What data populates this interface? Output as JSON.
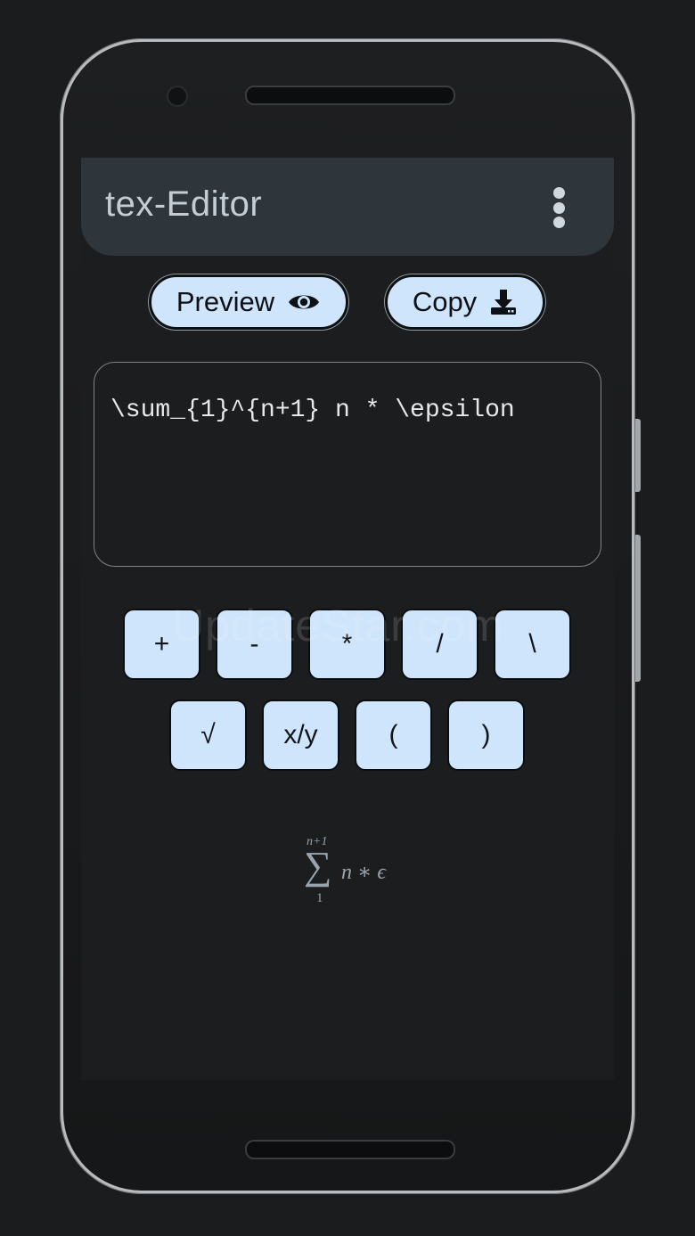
{
  "app": {
    "title": "tex-Editor"
  },
  "actions": {
    "preview_label": "Preview",
    "copy_label": "Copy"
  },
  "editor": {
    "value": "\\sum_{1}^{n+1} n * \\epsilon"
  },
  "keypad": {
    "row1": [
      "+",
      "-",
      "*",
      "/",
      "\\"
    ],
    "row2": [
      "√",
      "x/y",
      "(",
      ")"
    ]
  },
  "preview": {
    "upper": "n+1",
    "operator": "∑",
    "lower": "1",
    "body": "n ∗ ϵ"
  },
  "watermark": "UpdateStar.com",
  "colors": {
    "appbar": "#2e363c",
    "button": "#cfe5fb",
    "screen": "#1c1d1f"
  },
  "icons": {
    "preview": "eye-icon",
    "copy": "download-icon",
    "menu": "more-vert-icon"
  }
}
